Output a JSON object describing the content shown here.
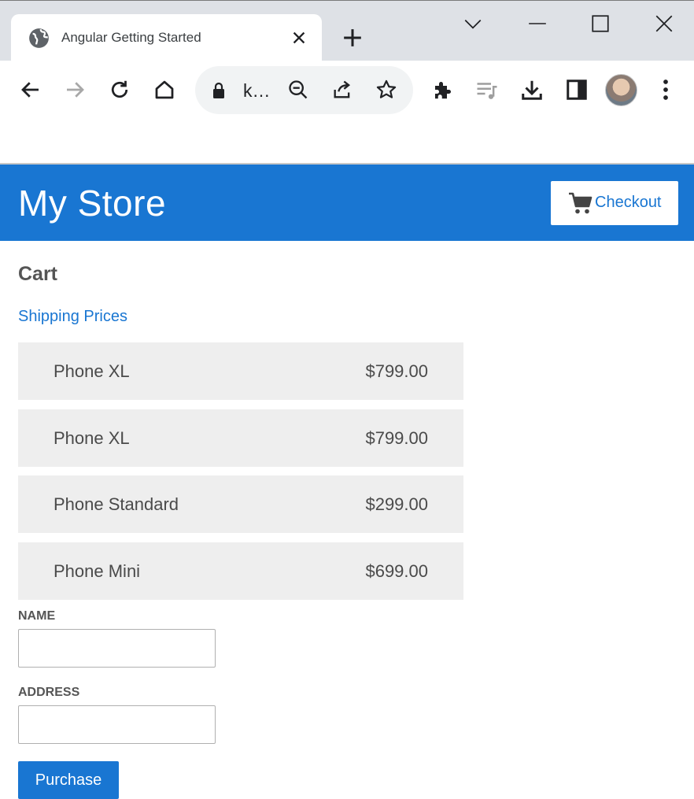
{
  "browser": {
    "tab_title": "Angular Getting Started",
    "address_text": "k…"
  },
  "header": {
    "store_title": "My Store",
    "checkout_label": "Checkout"
  },
  "cart": {
    "heading": "Cart",
    "shipping_link": "Shipping Prices",
    "items": [
      {
        "name": "Phone XL",
        "price": "$799.00"
      },
      {
        "name": "Phone XL",
        "price": "$799.00"
      },
      {
        "name": "Phone Standard",
        "price": "$299.00"
      },
      {
        "name": "Phone Mini",
        "price": "$699.00"
      }
    ]
  },
  "form": {
    "name_label": "NAME",
    "name_value": "",
    "address_label": "ADDRESS",
    "address_value": "",
    "purchase_label": "Purchase"
  },
  "colors": {
    "brand": "#1976d2",
    "item_background": "#eeeeee"
  },
  "icons": {
    "favicon": "globe-icon",
    "tab_close": "close-icon",
    "new_tab": "plus-icon",
    "cart": "shopping-cart-icon"
  }
}
